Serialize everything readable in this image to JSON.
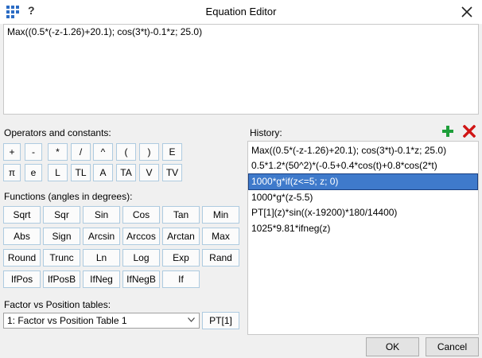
{
  "window": {
    "title": "Equation Editor",
    "help_label": "?"
  },
  "editor": {
    "value": "Max((0.5*(-z-1.26)+20.1); cos(3*t)-0.1*z; 25.0)"
  },
  "operators": {
    "label": "Operators and constants:",
    "row1": [
      "+",
      "-",
      "*",
      "/",
      "^",
      "(",
      ")",
      "E"
    ],
    "row2": [
      "π",
      "e",
      "L",
      "TL",
      "A",
      "TA",
      "V",
      "TV"
    ]
  },
  "functions": {
    "label": "Functions (angles in degrees):",
    "rows": [
      [
        "Sqrt",
        "Sqr",
        "Sin",
        "Cos",
        "Tan",
        "Min"
      ],
      [
        "Abs",
        "Sign",
        "Arcsin",
        "Arccos",
        "Arctan",
        "Max"
      ],
      [
        "Round",
        "Trunc",
        "Ln",
        "Log",
        "Exp",
        "Rand"
      ],
      [
        "IfPos",
        "IfPosB",
        "IfNeg",
        "IfNegB",
        "If"
      ]
    ]
  },
  "tables": {
    "label": "Factor vs Position tables:",
    "selected": "1: Factor vs Position Table 1",
    "insert_label": "PT[1]"
  },
  "history": {
    "label": "History:",
    "selected_index": 2,
    "items": [
      "Max((0.5*(-z-1.26)+20.1); cos(3*t)-0.1*z; 25.0)",
      "0.5*1.2*(50^2)*(-0.5+0.4*cos(t)+0.8*cos(2*t)",
      "1000*g*if(z<=5; z; 0)",
      "1000*g*(z-5.5)",
      "PT[1](z)*sin((x-19200)*180/14400)",
      "1025*9.81*ifneg(z)"
    ]
  },
  "footer": {
    "ok_label": "OK",
    "cancel_label": "Cancel"
  },
  "colors": {
    "accent_selection": "#3f7acb",
    "add_green": "#1e9e3a",
    "delete_red": "#d01515",
    "app_icon_blue": "#2b6cc4"
  }
}
